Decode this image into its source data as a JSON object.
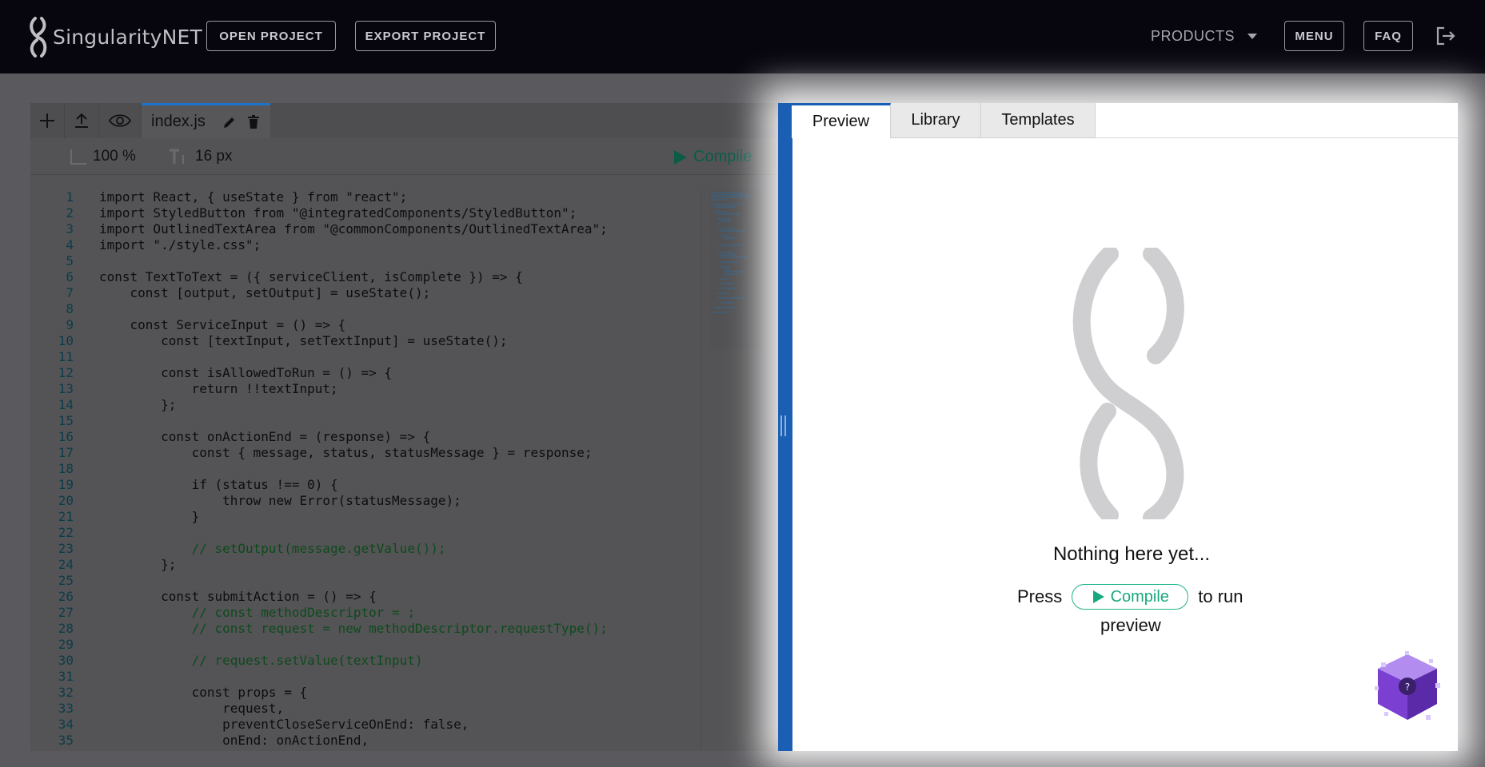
{
  "header": {
    "brand": "SingularityNET",
    "open_project": "OPEN PROJECT",
    "export_project": "EXPORT PROJECT",
    "products": "PRODUCTS",
    "menu": "MENU",
    "faq": "FAQ"
  },
  "editor": {
    "file_tab": "index.js",
    "zoom": "100 %",
    "font_size": "16 px",
    "compile": "Compile",
    "lines": [
      {
        "n": "1",
        "code": "import React, { useState } from \"react\";"
      },
      {
        "n": "2",
        "code": "import StyledButton from \"@integratedComponents/StyledButton\";"
      },
      {
        "n": "3",
        "code": "import OutlinedTextArea from \"@commonComponents/OutlinedTextArea\";"
      },
      {
        "n": "4",
        "code": "import \"./style.css\";"
      },
      {
        "n": "5",
        "code": ""
      },
      {
        "n": "6",
        "code": "const TextToText = ({ serviceClient, isComplete }) => {"
      },
      {
        "n": "7",
        "code": "    const [output, setOutput] = useState();"
      },
      {
        "n": "8",
        "code": ""
      },
      {
        "n": "9",
        "code": "    const ServiceInput = () => {"
      },
      {
        "n": "10",
        "code": "        const [textInput, setTextInput] = useState();"
      },
      {
        "n": "11",
        "code": ""
      },
      {
        "n": "12",
        "code": "        const isAllowedToRun = () => {"
      },
      {
        "n": "13",
        "code": "            return !!textInput;"
      },
      {
        "n": "14",
        "code": "        };"
      },
      {
        "n": "15",
        "code": ""
      },
      {
        "n": "16",
        "code": "        const onActionEnd = (response) => {"
      },
      {
        "n": "17",
        "code": "            const { message, status, statusMessage } = response;"
      },
      {
        "n": "18",
        "code": ""
      },
      {
        "n": "19",
        "code": "            if (status !== 0) {"
      },
      {
        "n": "20",
        "code": "                throw new Error(statusMessage);"
      },
      {
        "n": "21",
        "code": "            }"
      },
      {
        "n": "22",
        "code": ""
      },
      {
        "n": "23",
        "code": "            // setOutput(message.getValue());"
      },
      {
        "n": "24",
        "code": "        };"
      },
      {
        "n": "25",
        "code": ""
      },
      {
        "n": "26",
        "code": "        const submitAction = () => {"
      },
      {
        "n": "27",
        "code": "            // const methodDescriptor = ;"
      },
      {
        "n": "28",
        "code": "            // const request = new methodDescriptor.requestType();"
      },
      {
        "n": "29",
        "code": ""
      },
      {
        "n": "30",
        "code": "            // request.setValue(textInput)"
      },
      {
        "n": "31",
        "code": ""
      },
      {
        "n": "32",
        "code": "            const props = {"
      },
      {
        "n": "33",
        "code": "                request,"
      },
      {
        "n": "34",
        "code": "                preventCloseServiceOnEnd: false,"
      },
      {
        "n": "35",
        "code": "                onEnd: onActionEnd,"
      }
    ]
  },
  "preview": {
    "tabs": [
      "Preview",
      "Library",
      "Templates"
    ],
    "empty_title": "Nothing here yet...",
    "press": "Press",
    "compile": "Compile",
    "to_run": "to run",
    "preview_word": "preview"
  },
  "colors": {
    "accent_blue": "#1a5fb3",
    "compile_green": "#1db58b",
    "header_bg": "#07060f"
  }
}
